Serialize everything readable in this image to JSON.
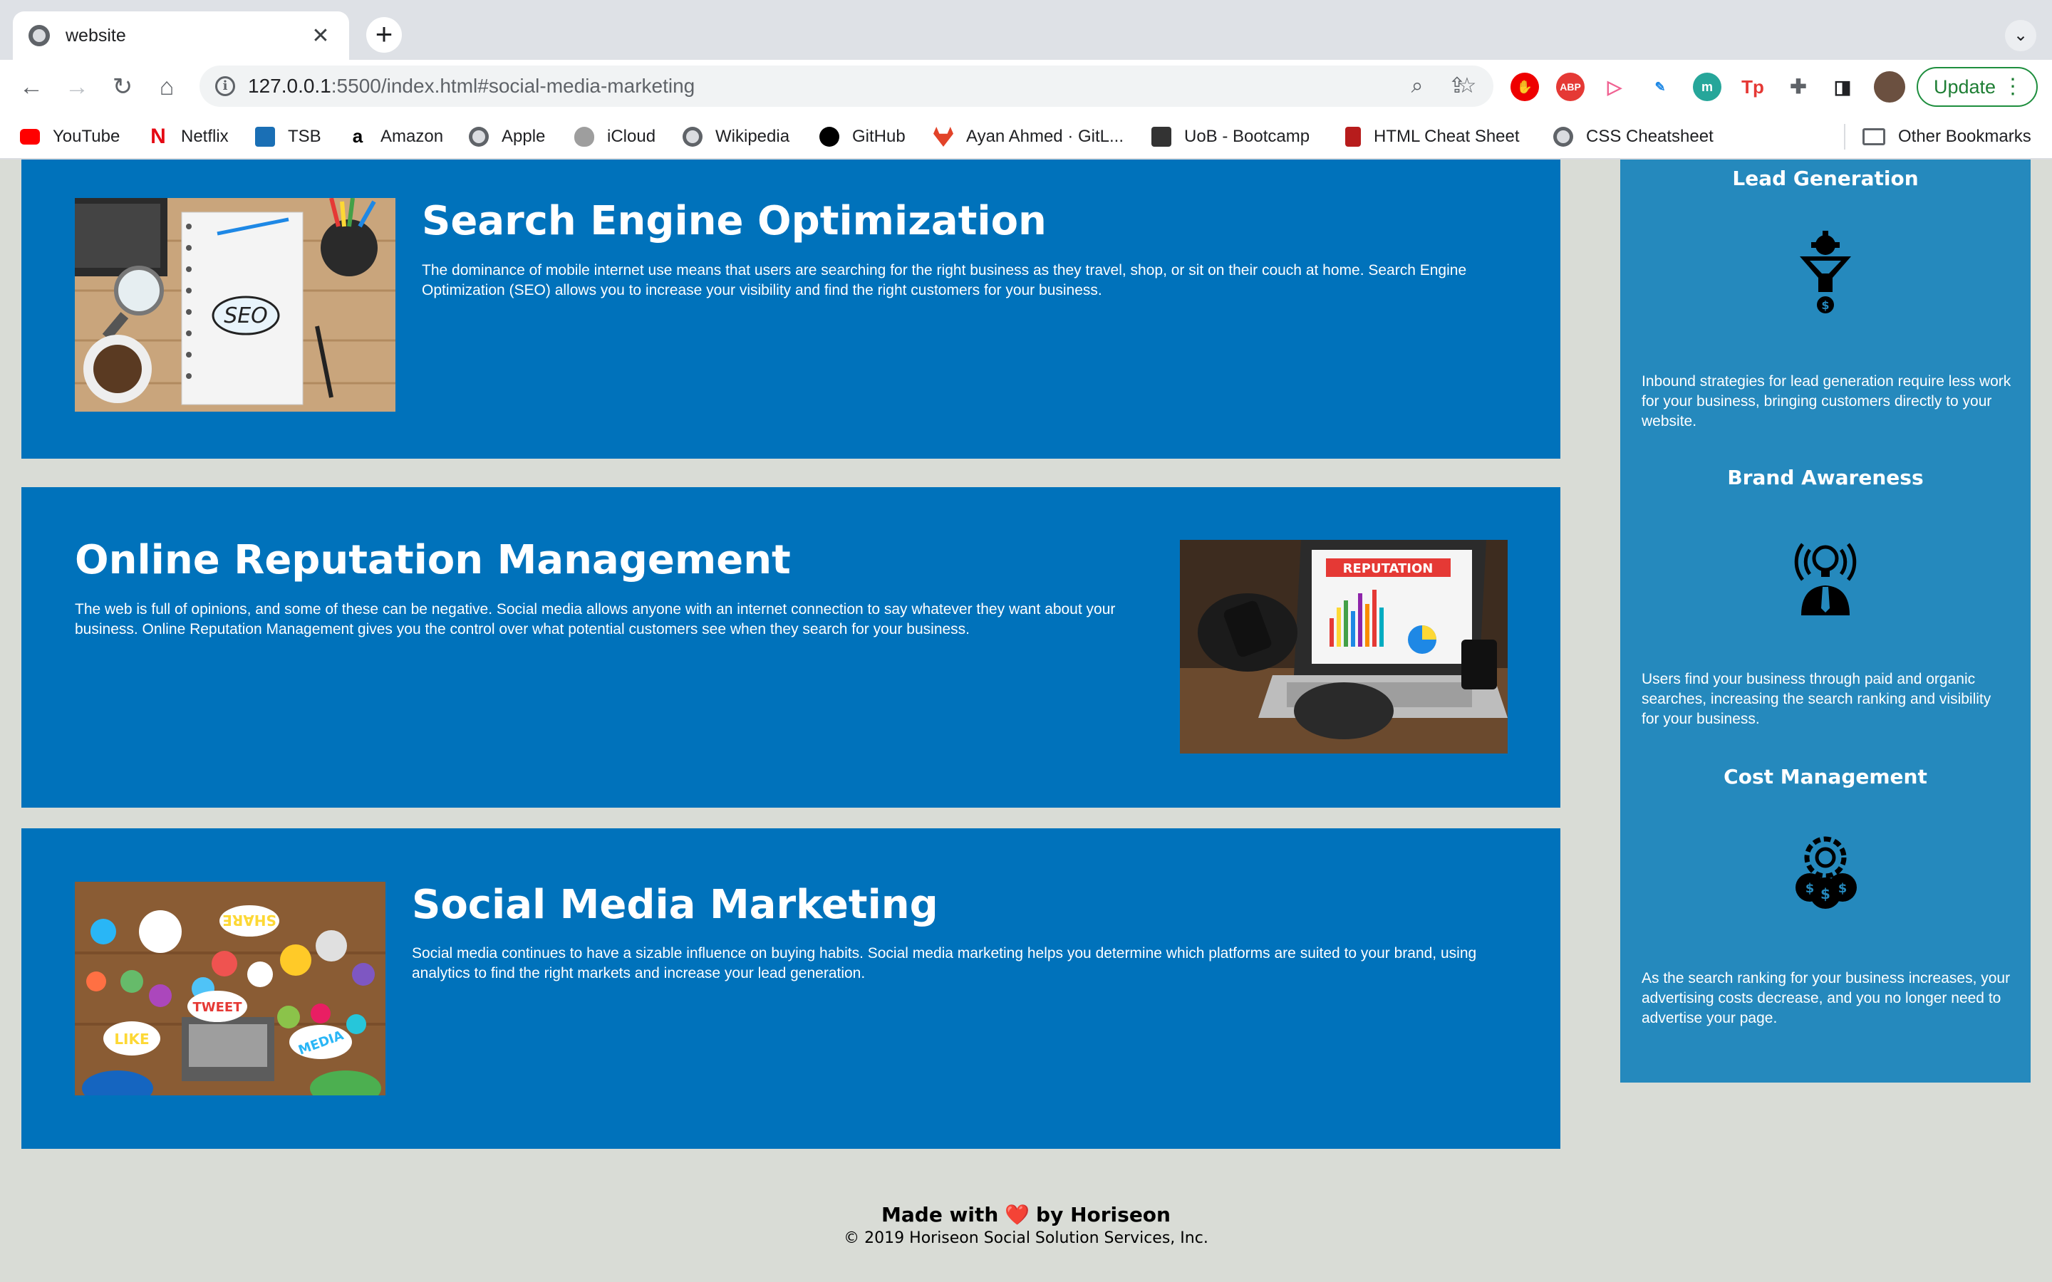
{
  "browser": {
    "tab_title": "website",
    "url_host": "127.0.0.1",
    "url_rest": ":5500/index.html#social-media-marketing",
    "update_label": "Update",
    "bookmarks": [
      {
        "label": "YouTube",
        "icon": "youtube-icon",
        "color": "#ff0000"
      },
      {
        "label": "Netflix",
        "icon": "netflix-icon",
        "color": "#e50914"
      },
      {
        "label": "TSB",
        "icon": "tsb-icon",
        "color": "#1a6fb5"
      },
      {
        "label": "Amazon",
        "icon": "amazon-icon",
        "color": "#000000"
      },
      {
        "label": "Apple",
        "icon": "globe-icon",
        "color": "#5f6368"
      },
      {
        "label": "iCloud",
        "icon": "apple-icon",
        "color": "#7d7d7d"
      },
      {
        "label": "Wikipedia",
        "icon": "globe-icon",
        "color": "#5f6368"
      },
      {
        "label": "GitHub",
        "icon": "github-icon",
        "color": "#000000"
      },
      {
        "label": "Ayan Ahmed · GitL...",
        "icon": "gitlab-icon",
        "color": "#e24329"
      },
      {
        "label": "UoB - Bootcamp",
        "icon": "bootcamp-icon",
        "color": "#333333"
      },
      {
        "label": "HTML Cheat Sheet",
        "icon": "html-icon",
        "color": "#b71c1c"
      },
      {
        "label": "CSS Cheatsheet",
        "icon": "globe-icon",
        "color": "#5f6368"
      }
    ],
    "other_bookmarks": "Other Bookmarks"
  },
  "content": {
    "seo": {
      "title": "Search Engine Optimization",
      "text": "The dominance of mobile internet use means that users are searching for the right business as they travel, shop, or sit on their couch at home. Search Engine Optimization (SEO) allows you to increase your visibility and find the right customers for your business.",
      "image_text": "SEO"
    },
    "orm": {
      "title": "Online Reputation Management",
      "text": "The web is full of opinions, and some of these can be negative. Social media allows anyone with an internet connection to say whatever they want about your business. Online Reputation Management gives you the control over what potential customers see when they search for your business.",
      "image_text": "REPUTATION"
    },
    "smm": {
      "title": "Social Media Marketing",
      "text": "Social media continues to have a sizable influence on buying habits. Social media marketing helps you determine which platforms are suited to your brand, using analytics to find the right markets and increase your lead generation.",
      "image_words": [
        "SHARE",
        "TWEET",
        "LIKE",
        "MEDIA"
      ]
    }
  },
  "benefits": {
    "lead": {
      "title": "Lead Generation",
      "text": "Inbound strategies for lead generation require less work for your business, bringing customers directly to your website."
    },
    "brand": {
      "title": "Brand Awareness",
      "text": "Users find your business through paid and organic searches, increasing the search ranking and visibility for your business."
    },
    "cost": {
      "title": "Cost Management",
      "text": "As the search ranking for your business increases, your advertising costs decrease, and you no longer need to advertise your page."
    }
  },
  "footer": {
    "made_with": "Made with",
    "heart": "❤️",
    "by": "by Horiseon",
    "copyright": "© 2019 Horiseon Social Solution Services, Inc."
  },
  "colors": {
    "content_bg": "#0072bb",
    "benefits_bg": "#2589bd",
    "page_bg": "#d9dcd6"
  }
}
